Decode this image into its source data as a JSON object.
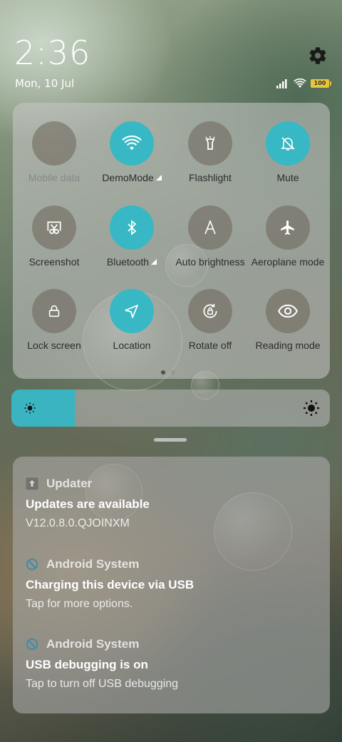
{
  "status_bar": {
    "time": "2:36",
    "date": "Mon, 10 Jul",
    "battery_level": "100",
    "settings_icon": "gear-icon",
    "signal_icon": "signal-icon",
    "wifi_icon": "wifi-icon"
  },
  "quick_settings": {
    "tiles": [
      {
        "label": "Mobile data",
        "icon": "mobile-data-icon",
        "active": false,
        "disabled": true
      },
      {
        "label": "DemoMode",
        "icon": "wifi-icon",
        "active": true,
        "expandable": true
      },
      {
        "label": "Flashlight",
        "icon": "flashlight-icon",
        "active": false
      },
      {
        "label": "Mute",
        "icon": "bell-off-icon",
        "active": true
      },
      {
        "label": "Screenshot",
        "icon": "screenshot-icon",
        "active": false
      },
      {
        "label": "Bluetooth",
        "icon": "bluetooth-icon",
        "active": true,
        "expandable": true
      },
      {
        "label": "Auto brightness",
        "icon": "auto-brightness-icon",
        "active": false
      },
      {
        "label": "Aeroplane mode",
        "icon": "airplane-icon",
        "active": false
      },
      {
        "label": "Lock screen",
        "icon": "lock-icon",
        "active": false
      },
      {
        "label": "Location",
        "icon": "location-icon",
        "active": true
      },
      {
        "label": "Rotate off",
        "icon": "rotate-lock-icon",
        "active": false
      },
      {
        "label": "Reading mode",
        "icon": "eye-icon",
        "active": false
      }
    ],
    "pages": 2,
    "current_page": 1
  },
  "brightness": {
    "level": 0.2,
    "accent": "#3ab4c0"
  },
  "notifications": [
    {
      "app": "Updater",
      "icon": "updater-icon",
      "title": "Updates are available",
      "text": "V12.0.8.0.QJOINXM"
    },
    {
      "app": "Android System",
      "icon": "android-system-icon",
      "title": "Charging this device via USB",
      "text": "Tap for more options."
    },
    {
      "app": "Android System",
      "icon": "android-system-icon",
      "title": "USB debugging is on",
      "text": "Tap to turn off USB debugging"
    }
  ],
  "colors": {
    "accent": "#38b8c4",
    "inactive_tile": "#6e645a"
  }
}
